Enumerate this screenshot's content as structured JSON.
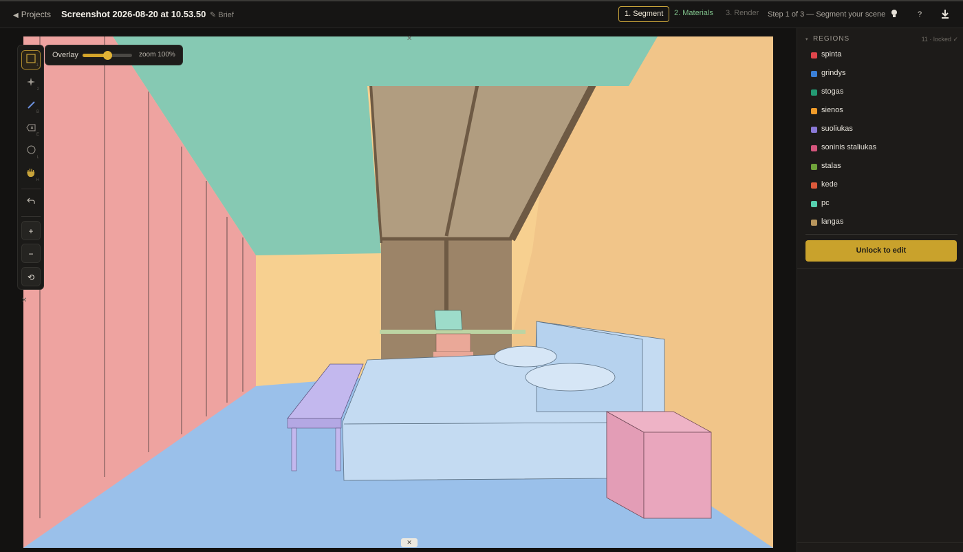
{
  "topbar": {
    "back_label": "Projects",
    "title": "Screenshot 2026-08-20 at 10.53.50",
    "brief_label": "✎ Brief",
    "steps": [
      {
        "label": "1. Segment",
        "state": "active"
      },
      {
        "label": "2. Materials",
        "state": "done"
      },
      {
        "label": "3. Render",
        "state": "pending"
      }
    ],
    "status": "Step 1 of 3 — Segment your scene",
    "icons": [
      "lightbulb-icon",
      "help-icon",
      "download-icon"
    ],
    "help_glyph": "?"
  },
  "overlay": {
    "label": "Overlay",
    "opacity": 0.5,
    "zoom_label": "zoom 100%"
  },
  "tools": [
    {
      "name": "box-select-tool",
      "key": "1",
      "active": true
    },
    {
      "name": "magic-wand-tool",
      "key": "2"
    },
    {
      "name": "brush-tool",
      "key": "B"
    },
    {
      "name": "eraser-tool",
      "key": "E"
    },
    {
      "name": "lasso-tool",
      "key": "L"
    },
    {
      "name": "hand-tool",
      "key": "H"
    },
    {
      "name": "undo-tool"
    },
    {
      "name": "zoom-in-button",
      "glyph": "+"
    },
    {
      "name": "zoom-out-button",
      "glyph": "−"
    },
    {
      "name": "reset-view-button",
      "glyph": "⟲"
    }
  ],
  "regions_panel": {
    "title": "REGIONS",
    "count_label": "11 · locked ✓",
    "items": [
      {
        "name": "spinta",
        "color": "#e0454b"
      },
      {
        "name": "grindys",
        "color": "#3a7fd6"
      },
      {
        "name": "stogas",
        "color": "#239a73"
      },
      {
        "name": "sienos",
        "color": "#ef9b2a"
      },
      {
        "name": "suoliukas",
        "color": "#8a79d6"
      },
      {
        "name": "soninis staliukas",
        "color": "#d5557c"
      },
      {
        "name": "stalas",
        "color": "#6fa33a"
      },
      {
        "name": "kede",
        "color": "#dd5a3b"
      },
      {
        "name": "pc",
        "color": "#56cfae"
      },
      {
        "name": "langas",
        "color": "#b8955c"
      }
    ],
    "unlock_label": "Unlock to edit"
  },
  "scene_colors": {
    "wardrobe": "#eea3a0",
    "floor": "#9ac0ea",
    "ceiling": "#86c9b3",
    "walls": "#f6cf90",
    "window": "#b19d80",
    "bench": "#c3b8ee",
    "bed": "#c4dbf2",
    "nightstand": "#e9a6bd",
    "desk": "#bcd4a3",
    "chair": "#eaa898",
    "pc": "#9ddcca"
  }
}
